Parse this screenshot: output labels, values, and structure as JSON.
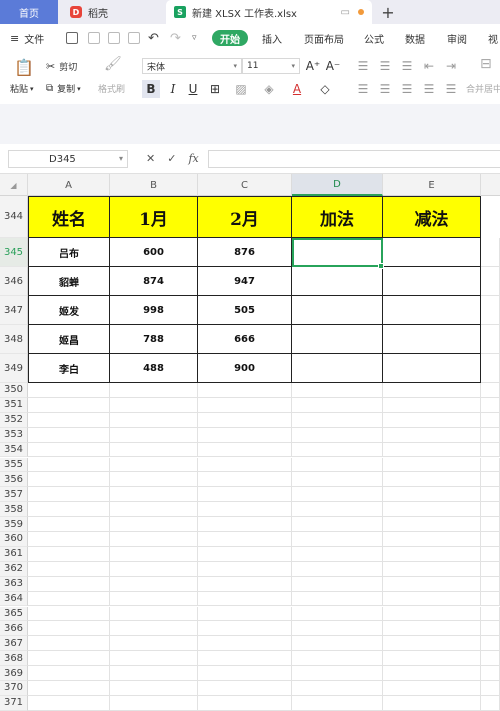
{
  "tabs": {
    "home": "首页",
    "daoke": "稻壳",
    "file": "新建 XLSX 工作表.xlsx",
    "new_tab": "+"
  },
  "menu": {
    "file": "文件",
    "start": "开始",
    "insert": "插入",
    "page_layout": "页面布局",
    "formula": "公式",
    "data": "数据",
    "review": "审阅",
    "view": "视"
  },
  "toolbar": {
    "cut": "剪切",
    "paste": "粘贴",
    "copy": "复制",
    "format_painter": "格式刷",
    "font_name": "宋体",
    "font_size": "11",
    "merge_center": "合并居中"
  },
  "formula_bar": {
    "cell_ref": "D345",
    "fx": "fx",
    "value": ""
  },
  "columns": [
    "A",
    "B",
    "C",
    "D",
    "E"
  ],
  "active_column": "D",
  "active_row": "345",
  "header_row": {
    "row": "344",
    "cells": [
      "姓名",
      "1月",
      "2月",
      "加法",
      "减法"
    ]
  },
  "data_rows": [
    {
      "row": "345",
      "cells": [
        "吕布",
        "600",
        "876",
        "",
        ""
      ]
    },
    {
      "row": "346",
      "cells": [
        "貂蝉",
        "874",
        "947",
        "",
        ""
      ]
    },
    {
      "row": "347",
      "cells": [
        "姬发",
        "998",
        "505",
        "",
        ""
      ]
    },
    {
      "row": "348",
      "cells": [
        "姬昌",
        "788",
        "666",
        "",
        ""
      ]
    },
    {
      "row": "349",
      "cells": [
        "李白",
        "488",
        "900",
        "",
        ""
      ]
    }
  ],
  "empty_rows": [
    "350",
    "351",
    "352",
    "353",
    "354",
    "355",
    "356",
    "357",
    "358",
    "359",
    "360",
    "361",
    "362",
    "363",
    "364",
    "365",
    "366",
    "367",
    "368",
    "369",
    "370",
    "371"
  ],
  "colors": {
    "header_fill": "#ffff00",
    "accent_green": "#2fa863",
    "home_tab": "#5b7bd8"
  }
}
